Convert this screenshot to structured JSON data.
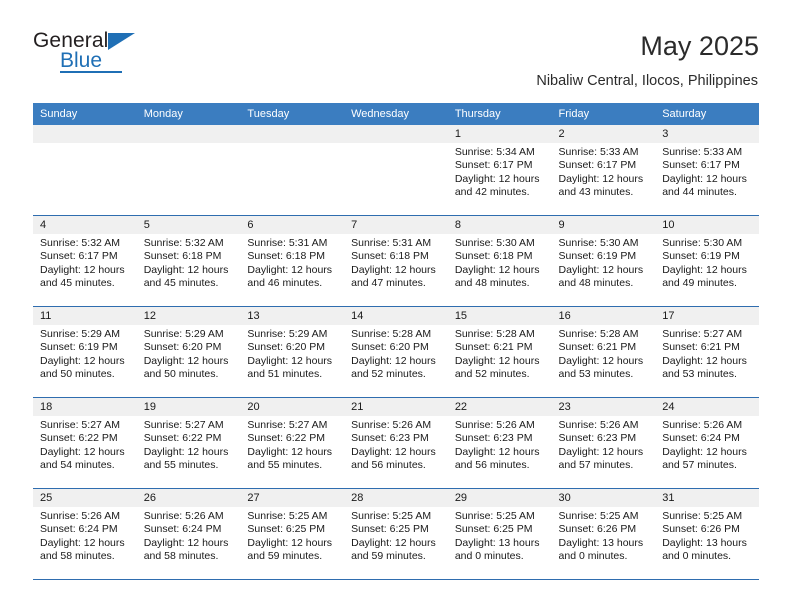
{
  "brand": {
    "name_part1": "General",
    "name_part2": "Blue",
    "logo_icon": "blue-triangle-logo",
    "accent_color": "#1f6fb5"
  },
  "header": {
    "title": "May 2025",
    "subtitle": "Nibaliw Central, Ilocos, Philippines"
  },
  "colors": {
    "header_band": "#3b7dc0",
    "grid_line": "#2f6daf",
    "daynum_band": "#f0f0f0",
    "text": "#1a1a1a"
  },
  "weekday_headers": [
    "Sunday",
    "Monday",
    "Tuesday",
    "Wednesday",
    "Thursday",
    "Friday",
    "Saturday"
  ],
  "weeks": [
    [
      {
        "day": "",
        "sunrise": "",
        "sunset": "",
        "daylight1": "",
        "daylight2": "",
        "empty": true
      },
      {
        "day": "",
        "sunrise": "",
        "sunset": "",
        "daylight1": "",
        "daylight2": "",
        "empty": true
      },
      {
        "day": "",
        "sunrise": "",
        "sunset": "",
        "daylight1": "",
        "daylight2": "",
        "empty": true
      },
      {
        "day": "",
        "sunrise": "",
        "sunset": "",
        "daylight1": "",
        "daylight2": "",
        "empty": true
      },
      {
        "day": "1",
        "sunrise": "Sunrise: 5:34 AM",
        "sunset": "Sunset: 6:17 PM",
        "daylight1": "Daylight: 12 hours",
        "daylight2": "and 42 minutes.",
        "empty": false
      },
      {
        "day": "2",
        "sunrise": "Sunrise: 5:33 AM",
        "sunset": "Sunset: 6:17 PM",
        "daylight1": "Daylight: 12 hours",
        "daylight2": "and 43 minutes.",
        "empty": false
      },
      {
        "day": "3",
        "sunrise": "Sunrise: 5:33 AM",
        "sunset": "Sunset: 6:17 PM",
        "daylight1": "Daylight: 12 hours",
        "daylight2": "and 44 minutes.",
        "empty": false
      }
    ],
    [
      {
        "day": "4",
        "sunrise": "Sunrise: 5:32 AM",
        "sunset": "Sunset: 6:17 PM",
        "daylight1": "Daylight: 12 hours",
        "daylight2": "and 45 minutes.",
        "empty": false
      },
      {
        "day": "5",
        "sunrise": "Sunrise: 5:32 AM",
        "sunset": "Sunset: 6:18 PM",
        "daylight1": "Daylight: 12 hours",
        "daylight2": "and 45 minutes.",
        "empty": false
      },
      {
        "day": "6",
        "sunrise": "Sunrise: 5:31 AM",
        "sunset": "Sunset: 6:18 PM",
        "daylight1": "Daylight: 12 hours",
        "daylight2": "and 46 minutes.",
        "empty": false
      },
      {
        "day": "7",
        "sunrise": "Sunrise: 5:31 AM",
        "sunset": "Sunset: 6:18 PM",
        "daylight1": "Daylight: 12 hours",
        "daylight2": "and 47 minutes.",
        "empty": false
      },
      {
        "day": "8",
        "sunrise": "Sunrise: 5:30 AM",
        "sunset": "Sunset: 6:18 PM",
        "daylight1": "Daylight: 12 hours",
        "daylight2": "and 48 minutes.",
        "empty": false
      },
      {
        "day": "9",
        "sunrise": "Sunrise: 5:30 AM",
        "sunset": "Sunset: 6:19 PM",
        "daylight1": "Daylight: 12 hours",
        "daylight2": "and 48 minutes.",
        "empty": false
      },
      {
        "day": "10",
        "sunrise": "Sunrise: 5:30 AM",
        "sunset": "Sunset: 6:19 PM",
        "daylight1": "Daylight: 12 hours",
        "daylight2": "and 49 minutes.",
        "empty": false
      }
    ],
    [
      {
        "day": "11",
        "sunrise": "Sunrise: 5:29 AM",
        "sunset": "Sunset: 6:19 PM",
        "daylight1": "Daylight: 12 hours",
        "daylight2": "and 50 minutes.",
        "empty": false
      },
      {
        "day": "12",
        "sunrise": "Sunrise: 5:29 AM",
        "sunset": "Sunset: 6:20 PM",
        "daylight1": "Daylight: 12 hours",
        "daylight2": "and 50 minutes.",
        "empty": false
      },
      {
        "day": "13",
        "sunrise": "Sunrise: 5:29 AM",
        "sunset": "Sunset: 6:20 PM",
        "daylight1": "Daylight: 12 hours",
        "daylight2": "and 51 minutes.",
        "empty": false
      },
      {
        "day": "14",
        "sunrise": "Sunrise: 5:28 AM",
        "sunset": "Sunset: 6:20 PM",
        "daylight1": "Daylight: 12 hours",
        "daylight2": "and 52 minutes.",
        "empty": false
      },
      {
        "day": "15",
        "sunrise": "Sunrise: 5:28 AM",
        "sunset": "Sunset: 6:21 PM",
        "daylight1": "Daylight: 12 hours",
        "daylight2": "and 52 minutes.",
        "empty": false
      },
      {
        "day": "16",
        "sunrise": "Sunrise: 5:28 AM",
        "sunset": "Sunset: 6:21 PM",
        "daylight1": "Daylight: 12 hours",
        "daylight2": "and 53 minutes.",
        "empty": false
      },
      {
        "day": "17",
        "sunrise": "Sunrise: 5:27 AM",
        "sunset": "Sunset: 6:21 PM",
        "daylight1": "Daylight: 12 hours",
        "daylight2": "and 53 minutes.",
        "empty": false
      }
    ],
    [
      {
        "day": "18",
        "sunrise": "Sunrise: 5:27 AM",
        "sunset": "Sunset: 6:22 PM",
        "daylight1": "Daylight: 12 hours",
        "daylight2": "and 54 minutes.",
        "empty": false
      },
      {
        "day": "19",
        "sunrise": "Sunrise: 5:27 AM",
        "sunset": "Sunset: 6:22 PM",
        "daylight1": "Daylight: 12 hours",
        "daylight2": "and 55 minutes.",
        "empty": false
      },
      {
        "day": "20",
        "sunrise": "Sunrise: 5:27 AM",
        "sunset": "Sunset: 6:22 PM",
        "daylight1": "Daylight: 12 hours",
        "daylight2": "and 55 minutes.",
        "empty": false
      },
      {
        "day": "21",
        "sunrise": "Sunrise: 5:26 AM",
        "sunset": "Sunset: 6:23 PM",
        "daylight1": "Daylight: 12 hours",
        "daylight2": "and 56 minutes.",
        "empty": false
      },
      {
        "day": "22",
        "sunrise": "Sunrise: 5:26 AM",
        "sunset": "Sunset: 6:23 PM",
        "daylight1": "Daylight: 12 hours",
        "daylight2": "and 56 minutes.",
        "empty": false
      },
      {
        "day": "23",
        "sunrise": "Sunrise: 5:26 AM",
        "sunset": "Sunset: 6:23 PM",
        "daylight1": "Daylight: 12 hours",
        "daylight2": "and 57 minutes.",
        "empty": false
      },
      {
        "day": "24",
        "sunrise": "Sunrise: 5:26 AM",
        "sunset": "Sunset: 6:24 PM",
        "daylight1": "Daylight: 12 hours",
        "daylight2": "and 57 minutes.",
        "empty": false
      }
    ],
    [
      {
        "day": "25",
        "sunrise": "Sunrise: 5:26 AM",
        "sunset": "Sunset: 6:24 PM",
        "daylight1": "Daylight: 12 hours",
        "daylight2": "and 58 minutes.",
        "empty": false
      },
      {
        "day": "26",
        "sunrise": "Sunrise: 5:26 AM",
        "sunset": "Sunset: 6:24 PM",
        "daylight1": "Daylight: 12 hours",
        "daylight2": "and 58 minutes.",
        "empty": false
      },
      {
        "day": "27",
        "sunrise": "Sunrise: 5:25 AM",
        "sunset": "Sunset: 6:25 PM",
        "daylight1": "Daylight: 12 hours",
        "daylight2": "and 59 minutes.",
        "empty": false
      },
      {
        "day": "28",
        "sunrise": "Sunrise: 5:25 AM",
        "sunset": "Sunset: 6:25 PM",
        "daylight1": "Daylight: 12 hours",
        "daylight2": "and 59 minutes.",
        "empty": false
      },
      {
        "day": "29",
        "sunrise": "Sunrise: 5:25 AM",
        "sunset": "Sunset: 6:25 PM",
        "daylight1": "Daylight: 13 hours",
        "daylight2": "and 0 minutes.",
        "empty": false
      },
      {
        "day": "30",
        "sunrise": "Sunrise: 5:25 AM",
        "sunset": "Sunset: 6:26 PM",
        "daylight1": "Daylight: 13 hours",
        "daylight2": "and 0 minutes.",
        "empty": false
      },
      {
        "day": "31",
        "sunrise": "Sunrise: 5:25 AM",
        "sunset": "Sunset: 6:26 PM",
        "daylight1": "Daylight: 13 hours",
        "daylight2": "and 0 minutes.",
        "empty": false
      }
    ]
  ]
}
